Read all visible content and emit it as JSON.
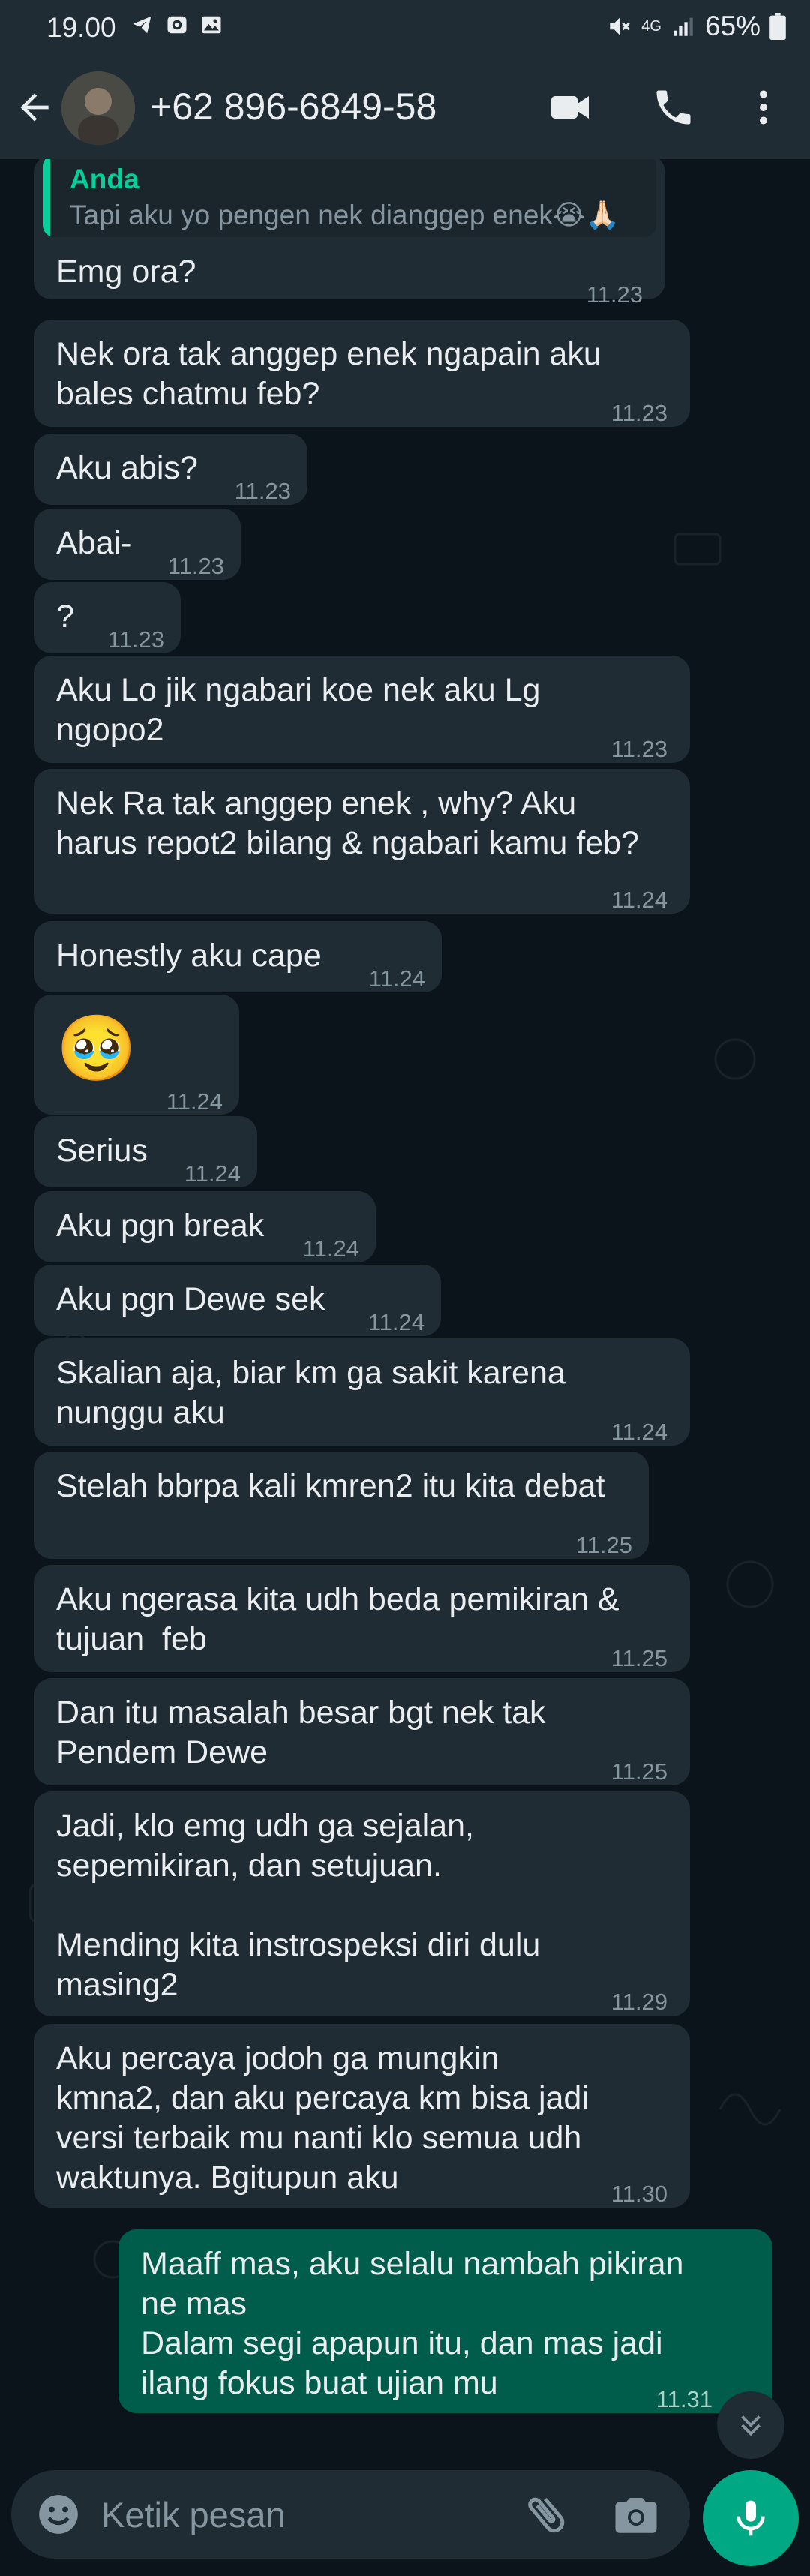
{
  "status_bar": {
    "time": "19.00",
    "battery": "65%",
    "network": "4G"
  },
  "header": {
    "contact": "+62 896-6849-58"
  },
  "quote": {
    "author": "Anda",
    "text": "Tapi aku yo pengen nek dianggep enek😭🙏🏻"
  },
  "messages": [
    {
      "text": "Emg ora?",
      "time": "11.23"
    },
    {
      "text": "Nek ora tak anggep enek ngapain aku\nbales chatmu feb?",
      "time": "11.23"
    },
    {
      "text": "Aku abis?",
      "time": "11.23"
    },
    {
      "text": "Abai-",
      "time": "11.23"
    },
    {
      "text": "?",
      "time": "11.23"
    },
    {
      "text": "Aku Lo jik ngabari koe nek aku Lg\nngopo2",
      "time": "11.23"
    },
    {
      "text": "Nek Ra tak anggep enek , why? Aku\nharus repot2 bilang & ngabari kamu feb?",
      "time": "11.24"
    },
    {
      "text": "Honestly aku cape",
      "time": "11.24"
    },
    {
      "text": "🥹",
      "time": "11.24"
    },
    {
      "text": "Serius",
      "time": "11.24"
    },
    {
      "text": "Aku pgn break",
      "time": "11.24"
    },
    {
      "text": "Aku pgn Dewe sek",
      "time": "11.24"
    },
    {
      "text": "Skalian aja, biar km ga sakit karena\nnunggu aku",
      "time": "11.24"
    },
    {
      "text": "Stelah bbrpa kali kmren2 itu kita debat",
      "time": "11.25"
    },
    {
      "text": "Aku ngerasa kita udh beda pemikiran &\ntujuan  feb",
      "time": "11.25"
    },
    {
      "text": "Dan itu masalah besar bgt nek tak\nPendem Dewe",
      "time": "11.25"
    },
    {
      "text": "Jadi, klo emg udh ga sejalan,\nsepemikiran, dan setujuan.\n\nMending kita instrospeksi diri dulu\nmasing2",
      "time": "11.29"
    },
    {
      "text": "Aku percaya jodoh ga mungkin\nkmna2, dan aku percaya km bisa jadi\nversi terbaik mu nanti klo semua udh\nwaktunya. Bgitupun aku",
      "time": "11.30"
    },
    {
      "text": "Maaff mas, aku selalu nambah pikiran\nne mas\nDalam segi apapun itu, dan mas jadi\nilang fokus buat ujian mu",
      "time": "11.31"
    }
  ],
  "input": {
    "placeholder": "Ketik pesan"
  }
}
